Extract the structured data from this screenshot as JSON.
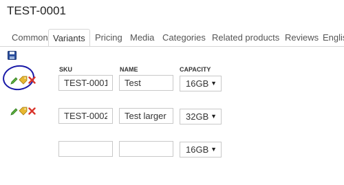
{
  "page": {
    "title": "TEST-0001"
  },
  "tabs": [
    {
      "label": "Common"
    },
    {
      "label": "Variants"
    },
    {
      "label": "Pricing"
    },
    {
      "label": "Media"
    },
    {
      "label": "Categories"
    },
    {
      "label": "Related products"
    },
    {
      "label": "Reviews"
    },
    {
      "label": "Englis"
    }
  ],
  "columns": {
    "sku": "SKU",
    "name": "NAME",
    "capacity": "CAPACITY"
  },
  "variants": [
    {
      "sku": "TEST-0001",
      "name": "Test",
      "capacity": "16GB"
    },
    {
      "sku": "TEST-0002",
      "name": "Test larger",
      "capacity": "32GB"
    },
    {
      "sku": "",
      "name": "",
      "capacity": "16GB"
    }
  ],
  "icons": {
    "save": "save-icon",
    "edit": "edit-icon",
    "tag": "tag-icon",
    "delete": "delete-icon"
  },
  "colors": {
    "annotation_circle": "#1a1aa8",
    "delete": "#d9342b",
    "edit": "#5cae3d",
    "tag": "#e8b830"
  }
}
